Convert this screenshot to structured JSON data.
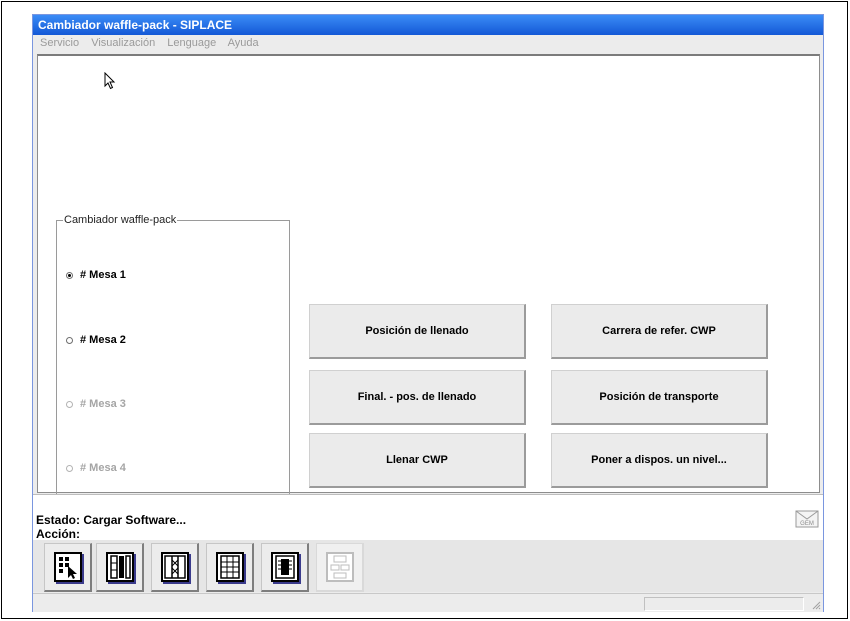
{
  "window": {
    "title": "Cambiador waffle-pack - SIPLACE"
  },
  "menu": {
    "items": [
      "Servicio",
      "Visualización",
      "Lenguage",
      "Ayuda"
    ]
  },
  "group": {
    "label": "Cambiador waffle-pack",
    "options": [
      {
        "label": "# Mesa 1",
        "selected": true,
        "enabled": true
      },
      {
        "label": "# Mesa 2",
        "selected": false,
        "enabled": true
      },
      {
        "label": "# Mesa 3",
        "selected": false,
        "enabled": false
      },
      {
        "label": "# Mesa 4",
        "selected": false,
        "enabled": false
      }
    ]
  },
  "actions": {
    "fill_position": "Posición de llenado",
    "cwp_reference_travel": "Carrera de refer. CWP",
    "end_fill_position": "Final. - pos. de llenado",
    "transport_position": "Posición de transporte",
    "fill_cwp": "Llenar CWP",
    "provide_level": "Poner a dispos. un nivel..."
  },
  "status": {
    "state_label": "Estado:",
    "state_value": "Cargar Software...",
    "action_label": "Acción:",
    "action_value": ""
  },
  "mail_icon_text": "GEM",
  "toolbar": {
    "buttons": [
      {
        "icon": "pointer-grid-icon",
        "enabled": true
      },
      {
        "icon": "tray-columns-icon",
        "enabled": true
      },
      {
        "icon": "tray-crossed-icon",
        "enabled": true
      },
      {
        "icon": "tray-grid-icon",
        "enabled": true
      },
      {
        "icon": "tray-chip-icon",
        "enabled": true
      },
      {
        "icon": "tray-tree-icon",
        "enabled": false
      }
    ]
  },
  "colors": {
    "titlebar_top": "#3b8cf6",
    "titlebar_bottom": "#1358d6",
    "disabled_text": "#a5a5a5"
  }
}
